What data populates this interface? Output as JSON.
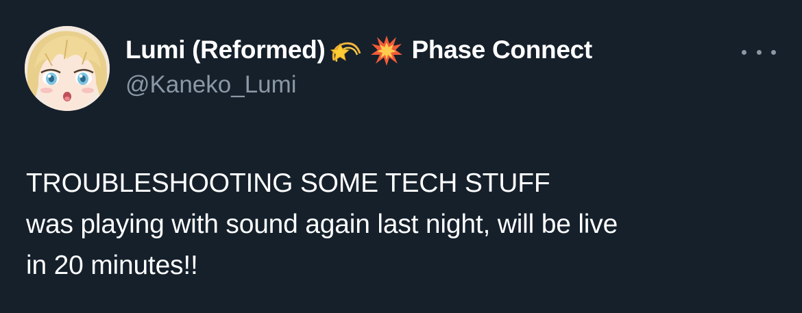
{
  "tweet": {
    "author": {
      "display_name": "Lumi (Reformed)",
      "emoji_1": "dizzy-star-emoji",
      "emoji_2": "collision-emoji",
      "display_name_suffix": "Phase Connect",
      "handle": "@Kaneko_Lumi",
      "avatar": "anime-character-avatar"
    },
    "more_icon": "more-horizontal-icon",
    "text_lines": [
      "TROUBLESHOOTING SOME TECH STUFF",
      "was playing with sound again last night, will be live",
      "in 20 minutes!!"
    ]
  },
  "colors": {
    "background": "#15202b",
    "primary_text": "#ffffff",
    "secondary_text": "#8b98a5"
  }
}
